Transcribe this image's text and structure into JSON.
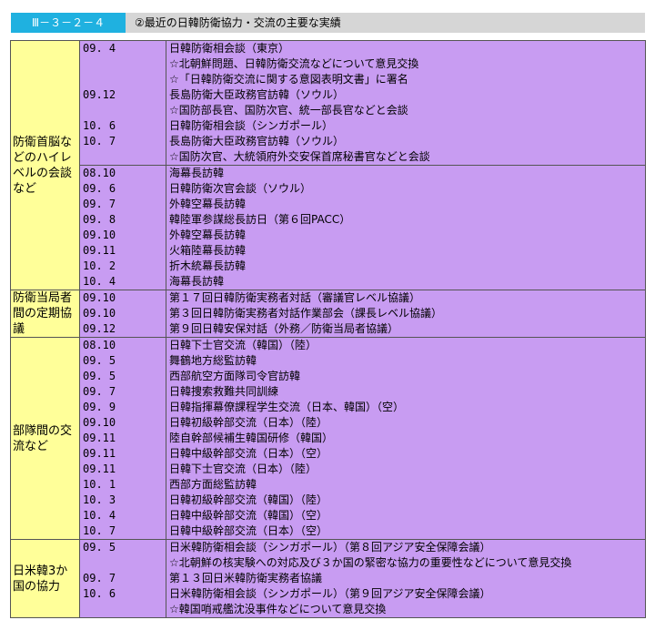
{
  "header": {
    "code": "Ⅲ－３－２－４",
    "title": "②最近の日韓防衛協力・交流の主要な実績"
  },
  "groups": [
    {
      "category_lines": [
        "防衛首脳な",
        "どのハイレ",
        "ベルの会談",
        "など"
      ],
      "blocks": [
        [
          {
            "date": "09. 4",
            "event": "日韓防衛相会談（東京）"
          },
          {
            "date": "",
            "event": "☆北朝鮮問題、日韓防衛交流などについて意見交換"
          },
          {
            "date": "",
            "event": "☆「日韓防衛交流に関する意図表明文書」に署名"
          },
          {
            "date": "09.12",
            "event": "長島防衛大臣政務官訪韓（ソウル）"
          },
          {
            "date": "",
            "event": "☆国防部長官、国防次官、統一部長官などと会談"
          },
          {
            "date": "10. 6",
            "event": "日韓防衛相会談（シンガポール）"
          },
          {
            "date": "10. 7",
            "event": "長島防衛大臣政務官訪韓（ソウル）"
          },
          {
            "date": "",
            "event": "☆国防次官、大統領府外交安保首席秘書官などと会談"
          }
        ],
        [
          {
            "date": "08.10",
            "event": "海幕長訪韓"
          },
          {
            "date": "09. 6",
            "event": "日韓防衛次官会談（ソウル）"
          },
          {
            "date": "09. 7",
            "event": "外韓空幕長訪韓"
          },
          {
            "date": "09. 8",
            "event": "韓陸軍参謀総長訪日（第６回PACC）"
          },
          {
            "date": "09.10",
            "event": "外韓空幕長訪韓"
          },
          {
            "date": "09.11",
            "event": "火箱陸幕長訪韓"
          },
          {
            "date": "10. 2",
            "event": "折木統幕長訪韓"
          },
          {
            "date": "10. 4",
            "event": "海幕長訪韓"
          }
        ]
      ]
    },
    {
      "category_lines": [
        "防衛当局者",
        "間の定期協",
        "議"
      ],
      "blocks": [
        [
          {
            "date": "09.10",
            "event": "第１７回日韓防衛実務者対話（審議官レベル協議）"
          },
          {
            "date": "09.10",
            "event": "第３回日韓防衛実務者対話作業部会（課長レベル協議）"
          },
          {
            "date": "09.12",
            "event": "第９回日韓安保対話（外務／防衛当局者協議）"
          }
        ]
      ]
    },
    {
      "category_lines": [
        "部隊間の交",
        "流など"
      ],
      "blocks": [
        [
          {
            "date": "08.10",
            "event": "日韓下士官交流（韓国）（陸）"
          },
          {
            "date": "09. 5",
            "event": "舞鶴地方総監訪韓"
          },
          {
            "date": "09. 5",
            "event": "西部航空方面隊司令官訪韓"
          },
          {
            "date": "09. 7",
            "event": "日韓捜索救難共同訓練"
          },
          {
            "date": "09. 9",
            "event": "日韓指揮幕僚課程学生交流（日本、韓国）（空）"
          },
          {
            "date": "09.10",
            "event": "日韓初級幹部交流（日本）（陸）"
          },
          {
            "date": "09.11",
            "event": "陸自幹部候補生韓国研修（韓国）"
          },
          {
            "date": "09.11",
            "event": "日韓中級幹部交流（日本）（空）"
          },
          {
            "date": "09.11",
            "event": "日韓下士官交流（日本）（陸）"
          },
          {
            "date": "10. 1",
            "event": "西部方面総監訪韓"
          },
          {
            "date": "10. 3",
            "event": "日韓初級幹部交流（韓国）（陸）"
          },
          {
            "date": "10. 4",
            "event": "日韓中級幹部交流（韓国）（空）"
          },
          {
            "date": "10. 7",
            "event": "日韓中級幹部交流（日本）（空）"
          }
        ]
      ]
    },
    {
      "category_lines": [
        "日米韓3か",
        "国の協力"
      ],
      "blocks": [
        [
          {
            "date": "09. 5",
            "event": "日米韓防衛相会談（シンガポール）（第８回アジア安全保障会議）"
          },
          {
            "date": "",
            "event": "☆北朝鮮の核実験への対応及び３か国の緊密な協力の重要性などについて意見交換"
          },
          {
            "date": "09. 7",
            "event": "第１３回日米韓防衛実務者協議"
          },
          {
            "date": "10. 6",
            "event": "日米韓防衛相会談（シンガポール）（第９回アジア安全保障会議）"
          },
          {
            "date": "",
            "event": "☆韓国哨戒艦沈没事件などについて意見交換"
          }
        ]
      ]
    }
  ]
}
